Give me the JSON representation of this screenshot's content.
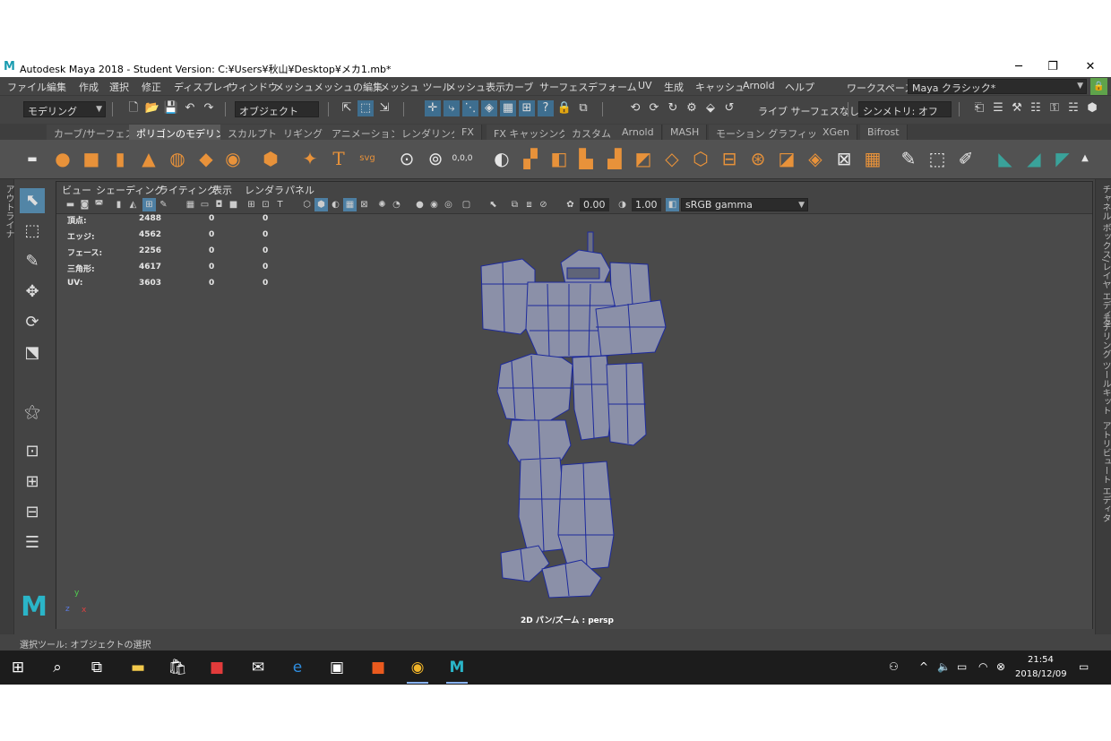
{
  "window": {
    "title": "Autodesk Maya 2018 - Student Version: C:¥Users¥秋山¥Desktop¥メカ1.mb*",
    "minimize": "─",
    "maximize": "❐",
    "close": "✕"
  },
  "menus": [
    "ファイル",
    "編集",
    "作成",
    "選択",
    "修正",
    "ディスプレイ",
    "ウィンドウ",
    "メッシュ",
    "メッシュの編集",
    "メッシュ ツール",
    "メッシュ表示",
    "カーブ",
    "サーフェス",
    "デフォーム",
    "UV",
    "生成",
    "キャッシュ",
    "Arnold",
    "ヘルプ"
  ],
  "workspace": {
    "label": "ワークスペース:",
    "value": "Maya クラシック*"
  },
  "status_line": {
    "mode": "モデリング",
    "selection_mask": "オブジェクト",
    "live_surface": "ライブ サーフェスなし",
    "symmetry": "シンメトリ: オフ"
  },
  "shelf_tabs": [
    "カーブ/サーフェス",
    "ポリゴンのモデリング",
    "スカルプト",
    "リギング",
    "アニメーション",
    "レンダリング",
    "FX",
    "FX キャッシング",
    "カスタム",
    "Arnold",
    "MASH",
    "モーション グラフィックス",
    "XGen",
    "Bifrost"
  ],
  "active_shelf_tab": "ポリゴンのモデリング",
  "shelf_text": {
    "text_tool": "T",
    "svg_tool": "svg",
    "coords": "0,0,0"
  },
  "side_labels": {
    "outliner": "アウトライナ",
    "channel_box": "チャネル ボックス/レイヤ エディタ",
    "modeling_toolkit": "モデリング ツールキット",
    "attribute_editor": "アトリビュート エディタ"
  },
  "panel_menus": [
    "ビュー",
    "シェーディング",
    "ライティング",
    "表示",
    "レンダラ",
    "パネル"
  ],
  "panel_toolbar": {
    "exposure": "0.00",
    "gamma": "1.00",
    "color_space": "sRGB gamma"
  },
  "hud": [
    {
      "label": "頂点:",
      "a": "2488",
      "b": "0",
      "c": "0"
    },
    {
      "label": "エッジ:",
      "a": "4562",
      "b": "0",
      "c": "0"
    },
    {
      "label": "フェース:",
      "a": "2256",
      "b": "0",
      "c": "0"
    },
    {
      "label": "三角形:",
      "a": "4617",
      "b": "0",
      "c": "0"
    },
    {
      "label": "UV:",
      "a": "3603",
      "b": "0",
      "c": "0"
    }
  ],
  "camera_label": "2D パン/ズーム : persp",
  "axis": {
    "x": "x",
    "y": "y",
    "z": "z"
  },
  "help_line": "選択ツール: オブジェクトの選択",
  "taskbar": {
    "time": "21:54",
    "date": "2018/12/09"
  },
  "colors": {
    "accent": "#5285a6",
    "shelf_orange": "#e8923a",
    "mesh_fill": "#8a8fa6",
    "mesh_wire": "#1d2a9c"
  }
}
